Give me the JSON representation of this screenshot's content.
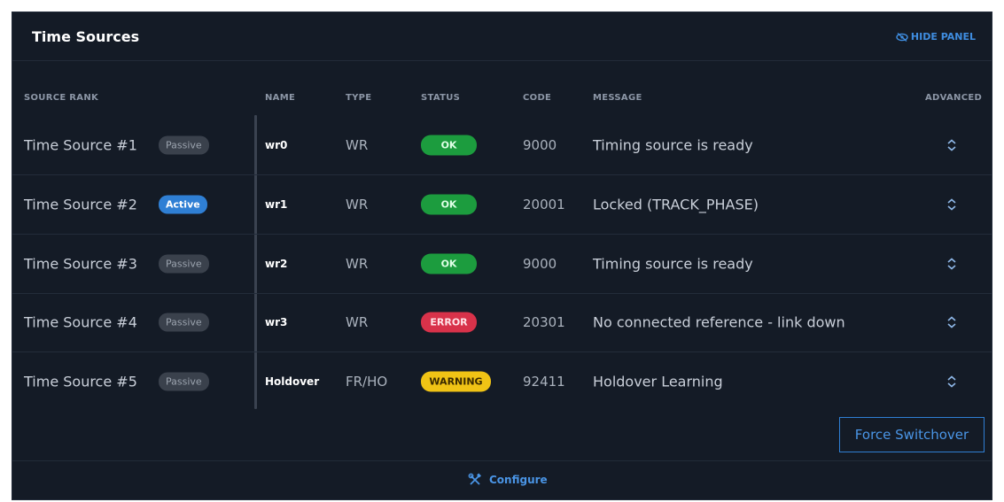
{
  "panel": {
    "title": "Time Sources",
    "hide_panel_label": "HIDE PANEL",
    "hide_panel_icon": "eye-slash-icon",
    "accent_color": "#3f8de0"
  },
  "table": {
    "columns": {
      "source_rank": "SOURCE RANK",
      "name": "NAME",
      "type": "TYPE",
      "status": "STATUS",
      "code": "CODE",
      "message": "MESSAGE",
      "advanced": "ADVANCED"
    },
    "rows": [
      {
        "source": "Time Source #1",
        "rank": "Passive",
        "name": "wr0",
        "type": "WR",
        "status": "OK",
        "code": "9000",
        "message": "Timing source is ready"
      },
      {
        "source": "Time Source #2",
        "rank": "Active",
        "name": "wr1",
        "type": "WR",
        "status": "OK",
        "code": "20001",
        "message": "Locked (TRACK_PHASE)"
      },
      {
        "source": "Time Source #3",
        "rank": "Passive",
        "name": "wr2",
        "type": "WR",
        "status": "OK",
        "code": "9000",
        "message": "Timing source is ready"
      },
      {
        "source": "Time Source #4",
        "rank": "Passive",
        "name": "wr3",
        "type": "WR",
        "status": "ERROR",
        "code": "20301",
        "message": "No connected reference - link down"
      },
      {
        "source": "Time Source #5",
        "rank": "Passive",
        "name": "Holdover",
        "type": "FR/HO",
        "status": "WARNING",
        "code": "92411",
        "message": "Holdover Learning"
      }
    ],
    "status_colors": {
      "OK": "#1c9c3e",
      "ERROR": "#d8324a",
      "WARNING": "#f0c315"
    },
    "advanced_icon": "chevron-up-down-icon"
  },
  "actions": {
    "force_switchover_label": "Force Switchover"
  },
  "footer": {
    "configure_label": "Configure",
    "configure_icon": "tools-icon"
  }
}
